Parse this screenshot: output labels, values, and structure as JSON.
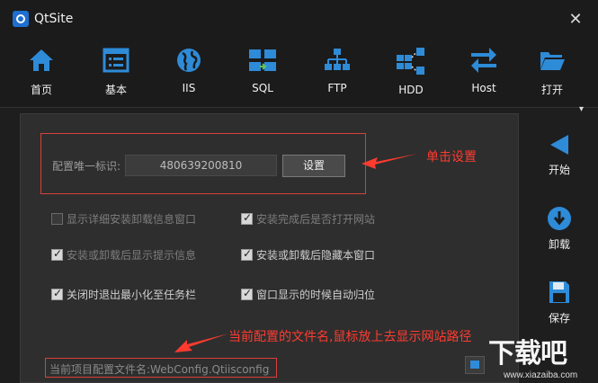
{
  "window": {
    "title": "QtSite",
    "close_glyph": "✕"
  },
  "toolbar": {
    "items": [
      {
        "label": "首页",
        "icon": "home-icon"
      },
      {
        "label": "基本",
        "icon": "list-icon"
      },
      {
        "label": "IIS",
        "icon": "globe-icon"
      },
      {
        "label": "SQL",
        "icon": "transfer-icon"
      },
      {
        "label": "FTP",
        "icon": "network-icon"
      },
      {
        "label": "HDD",
        "icon": "hdd-icon"
      },
      {
        "label": "Host",
        "icon": "arrows-icon"
      },
      {
        "label": "打开",
        "icon": "folder-icon"
      }
    ],
    "more_glyph": "▾"
  },
  "config": {
    "id_label": "配置唯一标识:",
    "id_value": "480639200810",
    "set_button": "设置"
  },
  "options": [
    {
      "label": "显示详细安装卸载信息窗口",
      "checked": false
    },
    {
      "label": "安装完成后是否打开网站",
      "checked": true
    },
    {
      "label": "安装或卸载后显示提示信息",
      "checked": true
    },
    {
      "label": "安装或卸载后隐藏本窗口",
      "checked": true
    },
    {
      "label": "关闭时退出最小化至任务栏",
      "checked": true
    },
    {
      "label": "窗口显示的时候自动归位",
      "checked": true
    }
  ],
  "config_file": "当前项目配置文件名:WebConfig.Qtiisconfig",
  "annotations": {
    "set_hint": "单击设置",
    "file_hint": "当前配置的文件名,鼠标放上去显示网站路径"
  },
  "side": {
    "start": "开始",
    "uninstall": "卸载",
    "save": "保存"
  },
  "watermark": {
    "text": "下载吧",
    "url": "www.xiazaiba.com"
  },
  "colors": {
    "accent_blue": "#2e8bd8",
    "annotation_red": "#ff3b30",
    "background": "#1e1e1e"
  }
}
